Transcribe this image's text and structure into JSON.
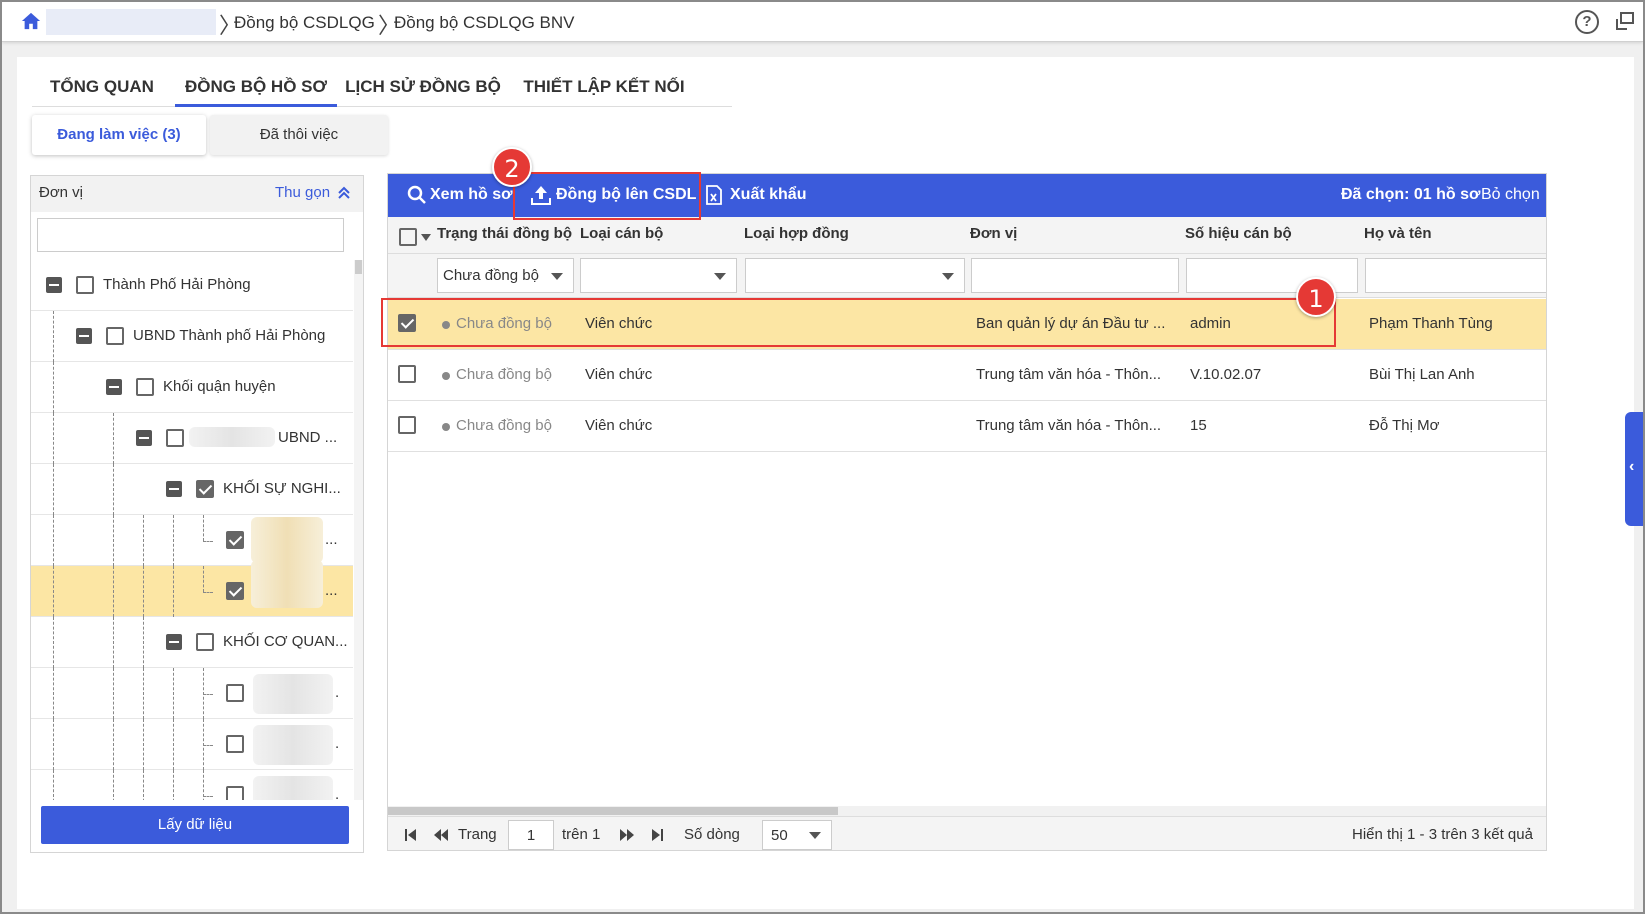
{
  "breadcrumb": {
    "items": [
      "Đồng bộ CSDLQG",
      "Đồng bộ CSDLQG BNV"
    ]
  },
  "tabs": [
    {
      "label": "TỔNG QUAN",
      "active": false
    },
    {
      "label": "ĐỒNG BỘ HỒ SƠ",
      "active": true
    },
    {
      "label": "LỊCH SỬ ĐỒNG BỘ",
      "active": false
    },
    {
      "label": "THIẾT LẬP KẾT NỐI",
      "active": false
    }
  ],
  "subtabs": {
    "working": "Đang làm việc (3)",
    "resigned": "Đã thôi việc"
  },
  "left_panel": {
    "title": "Đơn vị",
    "collapse_label": "Thu gọn",
    "search_value": "",
    "tree": [
      {
        "label": "Thành Phố Hải Phòng",
        "checked": false
      },
      {
        "label": "UBND Thành phố Hải Phòng",
        "checked": false
      },
      {
        "label": "Khối quận huyện",
        "checked": false
      },
      {
        "label": "UBND ...",
        "checked": false
      },
      {
        "label": "KHỐI SỰ NGHI...",
        "checked": true
      },
      {
        "label": "...",
        "checked": true
      },
      {
        "label": "...",
        "checked": true
      },
      {
        "label": "KHỐI CƠ QUAN...",
        "checked": false
      },
      {
        "label": ".",
        "checked": false
      },
      {
        "label": ".",
        "checked": false
      },
      {
        "label": ".",
        "checked": false
      }
    ],
    "fetch_button": "Lấy dữ liệu"
  },
  "toolbar": {
    "view": "Xem hồ sơ",
    "sync": "Đồng bộ lên CSDL",
    "export": "Xuất khẩu",
    "selected": "Đã chọn: 01 hồ sơ",
    "deselect": "Bỏ chọn"
  },
  "grid": {
    "columns": [
      "Trạng thái đồng bộ",
      "Loại cán bộ",
      "Loại hợp đồng",
      "Đơn vị",
      "Số hiệu cán bộ",
      "Họ và tên"
    ],
    "filters": {
      "status": "Chưa đồng bộ"
    },
    "rows": [
      {
        "checked": true,
        "status": "Chưa đồng bộ",
        "type": "Viên chức",
        "contract": "",
        "unit": "Ban quản lý dự án Đầu tư ...",
        "code": "admin",
        "name": "Phạm Thanh Tùng"
      },
      {
        "checked": false,
        "status": "Chưa đồng bộ",
        "type": "Viên chức",
        "contract": "",
        "unit": "Trung tâm văn hóa - Thôn...",
        "code": "V.10.02.07",
        "name": "Bùi Thị Lan Anh"
      },
      {
        "checked": false,
        "status": "Chưa đồng bộ",
        "type": "Viên chức",
        "contract": "",
        "unit": "Trung tâm văn hóa - Thôn...",
        "code": "15",
        "name": "Đỗ Thị Mơ"
      }
    ]
  },
  "pager": {
    "page_label": "Trang",
    "page": "1",
    "of_label": "trên 1",
    "rows_label": "Số dòng",
    "rows_per_page": "50",
    "summary": "Hiển thị 1 - 3 trên 3 kết quả"
  },
  "annotations": {
    "one": "1",
    "two": "2"
  },
  "colors": {
    "accent": "#3b5bdb",
    "selected_row": "#fce6a4",
    "annotation": "#e53935"
  }
}
